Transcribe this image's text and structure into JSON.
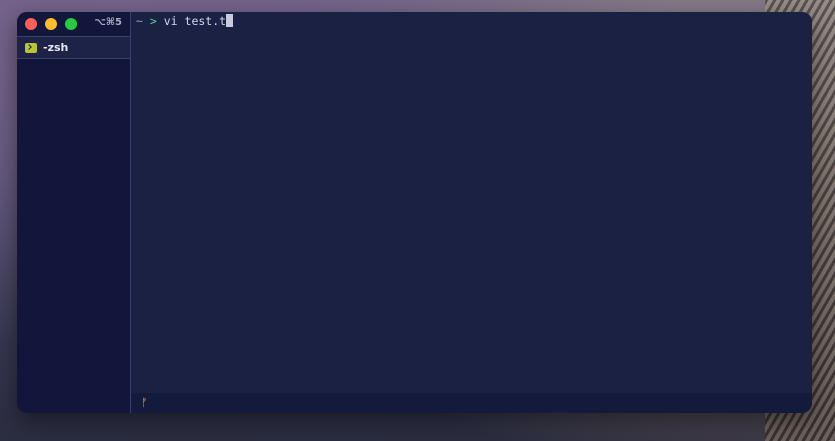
{
  "window": {
    "shortcut": "⌥⌘5"
  },
  "sidebar": {
    "tabs": [
      {
        "label": "-zsh",
        "icon": "terminal-icon"
      }
    ]
  },
  "terminal": {
    "prompt_symbol_home": "~",
    "prompt_arrow": ">",
    "command": "vi test.t"
  },
  "statusbar": {
    "icon": "git-branch-icon",
    "glyph": "ᚠ"
  },
  "colors": {
    "terminal_bg": "#1b2143",
    "sidebar_bg": "#11163a",
    "prompt_arrow": "#50d79a",
    "traffic_red": "#fe5f57",
    "traffic_yellow": "#febb2e",
    "traffic_green": "#28c840"
  }
}
